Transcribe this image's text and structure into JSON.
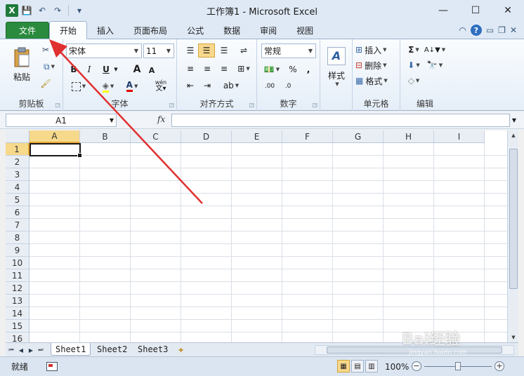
{
  "window": {
    "title": "工作簿1 - Microsoft Excel",
    "minimize": "—",
    "maximize": "☐",
    "close": "✕"
  },
  "qat": {
    "logo": "X",
    "save": "💾",
    "undo": "↶",
    "redo": "↷",
    "customize": "▾"
  },
  "tabs": {
    "file": "文件",
    "items": [
      "开始",
      "插入",
      "页面布局",
      "公式",
      "数据",
      "审阅",
      "视图"
    ],
    "help": "?"
  },
  "ribbon": {
    "clipboard": {
      "label": "剪贴板",
      "paste": "粘贴"
    },
    "font": {
      "label": "字体",
      "name": "宋体",
      "size": "11",
      "bold": "B",
      "italic": "I",
      "underline": "U",
      "grow": "A",
      "shrink": "A",
      "wen": "wén"
    },
    "alignment": {
      "label": "对齐方式"
    },
    "number": {
      "label": "数字",
      "format": "常规",
      "percent": "%",
      "comma": ",",
      "inc": ".00",
      "dec": ".0"
    },
    "styles": {
      "label": "样式",
      "button": "样式"
    },
    "cells": {
      "label": "单元格",
      "insert": "插入",
      "delete": "删除",
      "format": "格式"
    },
    "editing": {
      "label": "编辑",
      "sum": "Σ"
    }
  },
  "formula_bar": {
    "name_box": "A1",
    "fx": "fx",
    "value": ""
  },
  "grid": {
    "columns": [
      "A",
      "B",
      "C",
      "D",
      "E",
      "F",
      "G",
      "H",
      "I"
    ],
    "rows": [
      "1",
      "2",
      "3",
      "4",
      "5",
      "6",
      "7",
      "8",
      "9",
      "10",
      "11",
      "12",
      "13",
      "14",
      "15",
      "16"
    ],
    "active_cell": "A1"
  },
  "sheets": [
    "Sheet1",
    "Sheet2",
    "Sheet3"
  ],
  "status": {
    "ready": "就绪",
    "zoom": "100%"
  },
  "watermark": {
    "text": "Bai经验",
    "sub": "jingyan.baidu.com"
  }
}
